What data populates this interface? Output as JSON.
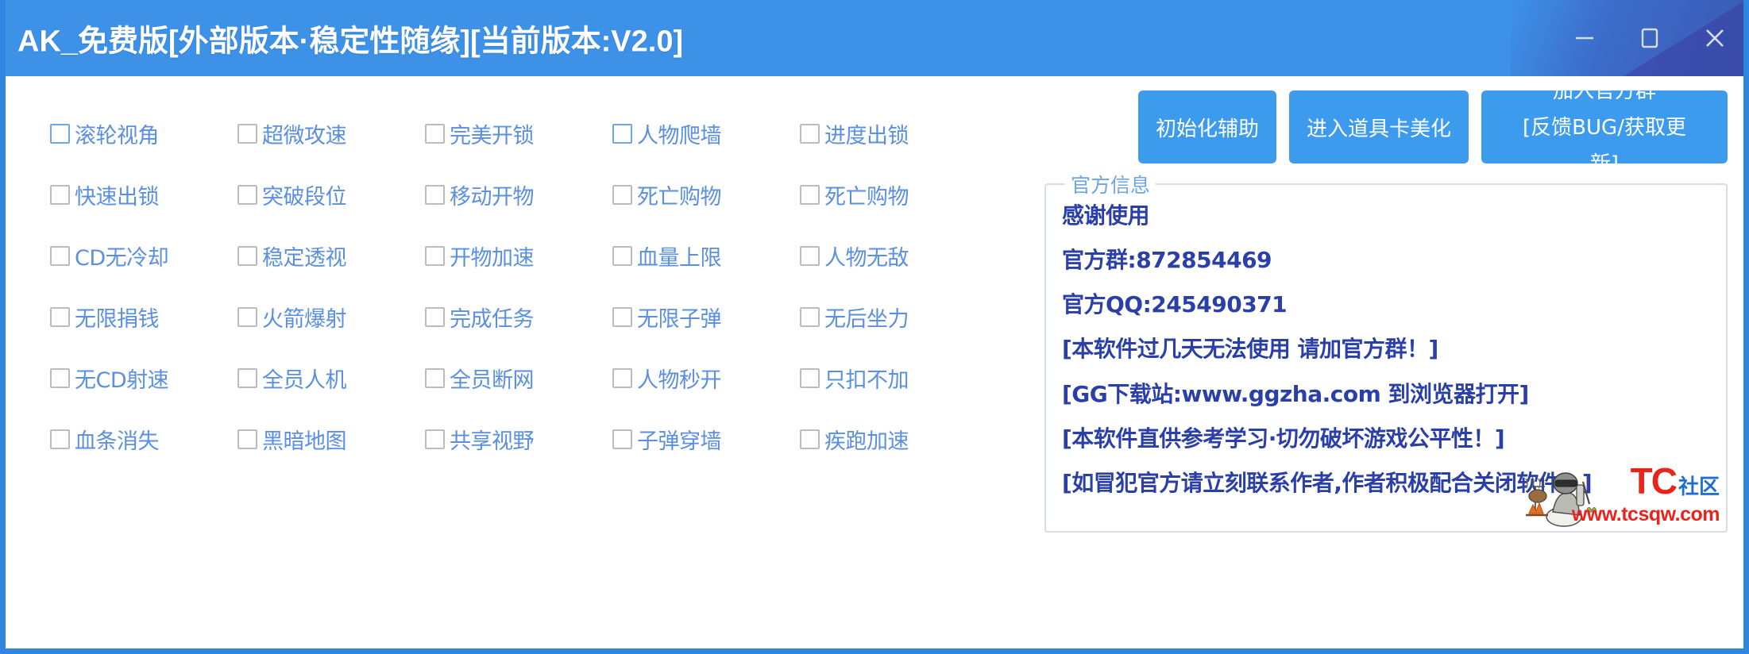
{
  "window": {
    "title": "AK_免费版[外部版本·稳定性随缘][当前版本:V2.0]",
    "accent_color": "#3d92e8",
    "wedge_color": "#3c4cb0",
    "controls": [
      {
        "name": "minimize",
        "glyph": "minimize-icon"
      },
      {
        "name": "maximize",
        "glyph": "maximize-icon"
      },
      {
        "name": "close",
        "glyph": "close-icon"
      }
    ]
  },
  "features": {
    "columns": 5,
    "items": [
      {
        "label": "滚轮视角",
        "checked": false,
        "accent": true
      },
      {
        "label": "超微攻速",
        "checked": false,
        "accent": false
      },
      {
        "label": "完美开锁",
        "checked": false,
        "accent": false
      },
      {
        "label": "人物爬墙",
        "checked": false,
        "accent": true
      },
      {
        "label": "进度出锁",
        "checked": false,
        "accent": false
      },
      {
        "label": "快速出锁",
        "checked": false,
        "accent": false
      },
      {
        "label": "突破段位",
        "checked": false,
        "accent": false
      },
      {
        "label": "移动开物",
        "checked": false,
        "accent": false
      },
      {
        "label": "死亡购物",
        "checked": false,
        "accent": false
      },
      {
        "label": "死亡购物",
        "checked": false,
        "accent": false
      },
      {
        "label": "CD无冷却",
        "checked": false,
        "accent": false
      },
      {
        "label": "稳定透视",
        "checked": false,
        "accent": false
      },
      {
        "label": "开物加速",
        "checked": false,
        "accent": false
      },
      {
        "label": "血量上限",
        "checked": false,
        "accent": false
      },
      {
        "label": "人物无敌",
        "checked": false,
        "accent": false
      },
      {
        "label": "无限捐钱",
        "checked": false,
        "accent": false
      },
      {
        "label": "火箭爆射",
        "checked": false,
        "accent": false
      },
      {
        "label": "完成任务",
        "checked": false,
        "accent": false
      },
      {
        "label": "无限子弹",
        "checked": false,
        "accent": false
      },
      {
        "label": "无后坐力",
        "checked": false,
        "accent": false
      },
      {
        "label": "无CD射速",
        "checked": false,
        "accent": false
      },
      {
        "label": "全员人机",
        "checked": false,
        "accent": false
      },
      {
        "label": "全员断网",
        "checked": false,
        "accent": false
      },
      {
        "label": "人物秒开",
        "checked": false,
        "accent": false
      },
      {
        "label": "只扣不加",
        "checked": false,
        "accent": false
      },
      {
        "label": "血条消失",
        "checked": false,
        "accent": false
      },
      {
        "label": "黑暗地图",
        "checked": false,
        "accent": false
      },
      {
        "label": "共享视野",
        "checked": false,
        "accent": false
      },
      {
        "label": "子弹穿墙",
        "checked": false,
        "accent": false
      },
      {
        "label": "疾跑加速",
        "checked": false,
        "accent": false
      }
    ]
  },
  "actions": {
    "init": "初始化辅助",
    "item_card": "进入道具卡美化",
    "join_group_line1": "加入官方群",
    "join_group_line2": "[反馈BUG/获取更",
    "join_group_line3": "新]"
  },
  "official_info": {
    "legend": "官方信息",
    "lines": [
      "感谢使用",
      "官方群:872854469",
      "官方QQ:245490371",
      "[本软件过几天无法使用  请加官方群！]",
      "[GG下载站:www.ggzha.com 到浏览器打开]",
      "[本软件直供参考学习·切勿破坏游戏公平性！]",
      "[如冒犯官方请立刻联系作者,作者积极配合关闭软件！]"
    ]
  },
  "watermark": {
    "brand": "TC",
    "brand_suffix": "社区",
    "url": "www.tcsqw.com",
    "brand_color": "#e8241c",
    "suffix_color": "#1f6fd0"
  }
}
